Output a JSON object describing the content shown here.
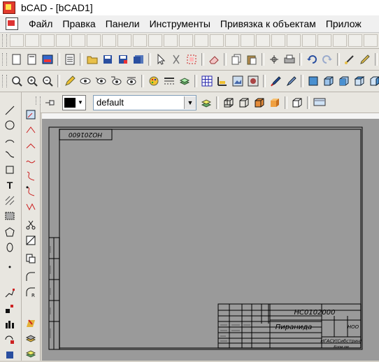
{
  "window": {
    "title": "bCAD - [bCAD1]"
  },
  "menu": {
    "items": [
      "Файл",
      "Правка",
      "Панели",
      "Инструменты",
      "Привязка к объектам",
      "Прилож"
    ]
  },
  "layer": {
    "name": "default",
    "color": "#000000"
  },
  "drawing": {
    "top_code": "НО201600",
    "stamp_code": "НС0102000",
    "stamp_title": "Пиранида",
    "stamp_sheet": "НОО",
    "stamp_org": "НГАСУ(Сибстрин)",
    "stamp_bottom": "Копи ом"
  },
  "icons": {
    "tb2": [
      "new-doc-icon",
      "new-doc2-icon",
      "image-icon",
      "list-icon",
      "open-folder-icon",
      "save-icon",
      "save-as-icon",
      "save-all-icon",
      "pointer-icon",
      "cut-icon",
      "select-rect-icon",
      "eraser-icon",
      "copy-icon",
      "paste-icon",
      "transform-icon",
      "print-icon",
      "undo-icon",
      "redo-icon",
      "measure-icon",
      "pen-icon",
      "crosshair-icon",
      "grid-icon"
    ],
    "tb3": [
      "zoom-in-icon",
      "zoom-all-icon",
      "zoom-window-icon",
      "pencil-icon",
      "view-icon",
      "view2-icon",
      "view3-icon",
      "view4-icon",
      "palette-icon",
      "lines-icon",
      "layers-icon",
      "grid-table-icon",
      "ruler-icon",
      "image-edit-icon",
      "render-icon",
      "brush-icon",
      "pen2-icon",
      "cube-front-icon",
      "cube-iso-icon",
      "cube-side-icon",
      "cube-top-icon",
      "cube-back-icon",
      "cube-3d-icon",
      "cube-extra-icon"
    ],
    "tb4": [
      "pin-icon",
      "layers-stack-icon",
      "wire-box-icon",
      "wire-box2-icon",
      "shaded-box-icon",
      "solid-box-icon",
      "outline-box-icon",
      "monitor-icon"
    ]
  }
}
